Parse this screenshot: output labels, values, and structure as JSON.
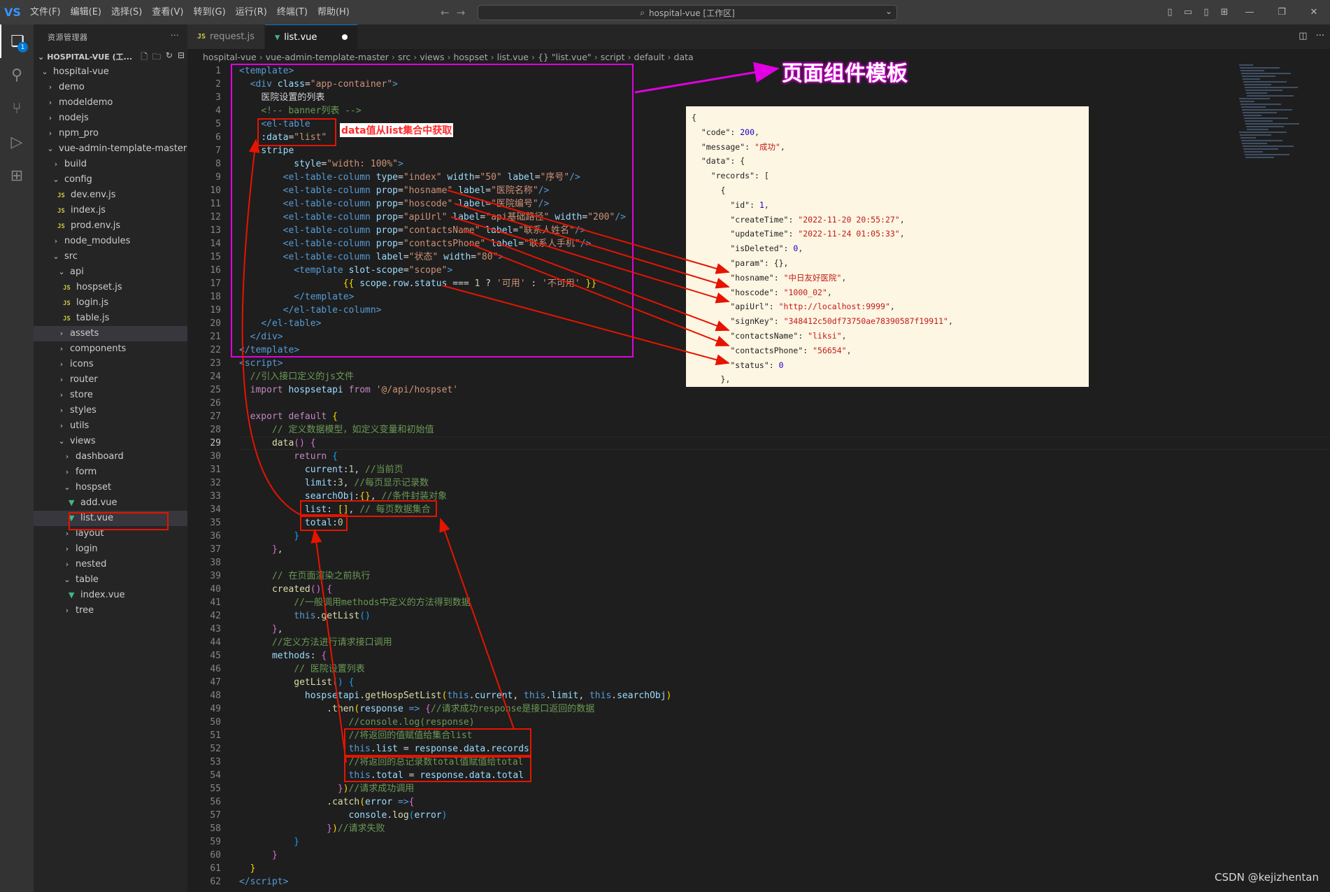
{
  "titlebar": {
    "logo": "VS",
    "menu": [
      "文件(F)",
      "编辑(E)",
      "选择(S)",
      "查看(V)",
      "转到(G)",
      "运行(R)",
      "终端(T)",
      "帮助(H)"
    ],
    "search": "hospital-vue [工作区]"
  },
  "sidebar": {
    "title": "资源管理器",
    "section": "HOSPITAL-VUE (工...",
    "items": [
      {
        "depth": 1,
        "type": "folder",
        "open": true,
        "label": "hospital-vue"
      },
      {
        "depth": 2,
        "type": "folder",
        "open": false,
        "label": "demo"
      },
      {
        "depth": 2,
        "type": "folder",
        "open": false,
        "label": "modeldemo"
      },
      {
        "depth": 2,
        "type": "folder",
        "open": false,
        "label": "nodejs"
      },
      {
        "depth": 2,
        "type": "folder",
        "open": false,
        "label": "npm_pro"
      },
      {
        "depth": 2,
        "type": "folder",
        "open": true,
        "label": "vue-admin-template-master"
      },
      {
        "depth": 3,
        "type": "folder",
        "open": false,
        "label": "build"
      },
      {
        "depth": 3,
        "type": "folder",
        "open": true,
        "label": "config"
      },
      {
        "depth": 4,
        "type": "js",
        "label": "dev.env.js"
      },
      {
        "depth": 4,
        "type": "js",
        "label": "index.js"
      },
      {
        "depth": 4,
        "type": "js",
        "label": "prod.env.js"
      },
      {
        "depth": 3,
        "type": "folder",
        "open": false,
        "label": "node_modules"
      },
      {
        "depth": 3,
        "type": "folder",
        "open": true,
        "label": "src"
      },
      {
        "depth": 4,
        "type": "folder",
        "open": true,
        "label": "api"
      },
      {
        "depth": 5,
        "type": "js",
        "label": "hospset.js"
      },
      {
        "depth": 5,
        "type": "js",
        "label": "login.js"
      },
      {
        "depth": 5,
        "type": "js",
        "label": "table.js"
      },
      {
        "depth": 4,
        "type": "folder",
        "open": false,
        "label": "assets",
        "selected": true
      },
      {
        "depth": 4,
        "type": "folder",
        "open": false,
        "label": "components"
      },
      {
        "depth": 4,
        "type": "folder",
        "open": false,
        "label": "icons"
      },
      {
        "depth": 4,
        "type": "folder",
        "open": false,
        "label": "router"
      },
      {
        "depth": 4,
        "type": "folder",
        "open": false,
        "label": "store"
      },
      {
        "depth": 4,
        "type": "folder",
        "open": false,
        "label": "styles"
      },
      {
        "depth": 4,
        "type": "folder",
        "open": false,
        "label": "utils"
      },
      {
        "depth": 4,
        "type": "folder",
        "open": true,
        "label": "views"
      },
      {
        "depth": 5,
        "type": "folder",
        "open": false,
        "label": "dashboard"
      },
      {
        "depth": 5,
        "type": "folder",
        "open": false,
        "label": "form"
      },
      {
        "depth": 5,
        "type": "folder",
        "open": true,
        "label": "hospset"
      },
      {
        "depth": 6,
        "type": "vue",
        "label": "add.vue"
      },
      {
        "depth": 6,
        "type": "vue",
        "label": "list.vue",
        "selected": true
      },
      {
        "depth": 5,
        "type": "folder",
        "open": false,
        "label": "layout"
      },
      {
        "depth": 5,
        "type": "folder",
        "open": false,
        "label": "login"
      },
      {
        "depth": 5,
        "type": "folder",
        "open": false,
        "label": "nested"
      },
      {
        "depth": 5,
        "type": "folder",
        "open": true,
        "label": "table"
      },
      {
        "depth": 6,
        "type": "vue",
        "label": "index.vue"
      },
      {
        "depth": 5,
        "type": "folder",
        "open": false,
        "label": "tree"
      }
    ]
  },
  "tabs": [
    {
      "icon": "JS",
      "label": "request.js",
      "active": false
    },
    {
      "icon": "vue",
      "label": "list.vue",
      "active": true
    }
  ],
  "breadcrumb": [
    "hospital-vue",
    "vue-admin-template-master",
    "src",
    "views",
    "hospset",
    "list.vue",
    "{} \"list.vue\"",
    "script",
    "default",
    "data"
  ],
  "code_lines": [
    {
      "n": 1,
      "html": "<span class='tag'>&lt;template&gt;</span>"
    },
    {
      "n": 2,
      "html": "  <span class='tag'>&lt;div</span> <span class='attr'>class</span><span class='txt'>=</span><span class='str'>\"app-container\"</span><span class='tag'>&gt;</span>"
    },
    {
      "n": 3,
      "html": "    <span class='txt'>医院设置的列表</span>"
    },
    {
      "n": 4,
      "html": "    <span class='com'>&lt;!-- banner列表 --&gt;</span>"
    },
    {
      "n": 5,
      "html": "    <span class='tag'>&lt;el-table</span>"
    },
    {
      "n": 6,
      "html": "    <span class='attr'>:data</span><span class='txt'>=</span><span class='str'>\"list\"</span>"
    },
    {
      "n": 7,
      "html": "    <span class='attr'>stripe</span>"
    },
    {
      "n": 8,
      "html": "          <span class='attr'>style</span><span class='txt'>=</span><span class='str'>\"width: 100%\"</span><span class='tag'>&gt;</span>"
    },
    {
      "n": 9,
      "html": "        <span class='tag'>&lt;el-table-column</span> <span class='attr'>type</span><span class='txt'>=</span><span class='str'>\"index\"</span> <span class='attr'>width</span><span class='txt'>=</span><span class='str'>\"50\"</span> <span class='attr'>label</span><span class='txt'>=</span><span class='str'>\"序号\"</span><span class='tag'>/&gt;</span>"
    },
    {
      "n": 10,
      "html": "        <span class='tag'>&lt;el-table-column</span> <span class='attr'>prop</span><span class='txt'>=</span><span class='str'>\"hosname\"</span> <span class='attr'>label</span><span class='txt'>=</span><span class='str'>\"医院名称\"</span><span class='tag'>/&gt;</span>"
    },
    {
      "n": 11,
      "html": "        <span class='tag'>&lt;el-table-column</span> <span class='attr'>prop</span><span class='txt'>=</span><span class='str'>\"hoscode\"</span> <span class='attr'>label</span><span class='txt'>=</span><span class='str'>\"医院编号\"</span><span class='tag'>/&gt;</span>"
    },
    {
      "n": 12,
      "html": "        <span class='tag'>&lt;el-table-column</span> <span class='attr'>prop</span><span class='txt'>=</span><span class='str'>\"apiUrl\"</span> <span class='attr'>label</span><span class='txt'>=</span><span class='str'>\"api基础路径\"</span> <span class='attr'>width</span><span class='txt'>=</span><span class='str'>\"200\"</span><span class='tag'>/&gt;</span>"
    },
    {
      "n": 13,
      "html": "        <span class='tag'>&lt;el-table-column</span> <span class='attr'>prop</span><span class='txt'>=</span><span class='str'>\"contactsName\"</span> <span class='attr'>label</span><span class='txt'>=</span><span class='str'>\"联系人姓名\"</span><span class='tag'>/&gt;</span>"
    },
    {
      "n": 14,
      "html": "        <span class='tag'>&lt;el-table-column</span> <span class='attr'>prop</span><span class='txt'>=</span><span class='str'>\"contactsPhone\"</span> <span class='attr'>label</span><span class='txt'>=</span><span class='str'>\"联系人手机\"</span><span class='tag'>/&gt;</span>"
    },
    {
      "n": 15,
      "html": "        <span class='tag'>&lt;el-table-column</span> <span class='attr'>label</span><span class='txt'>=</span><span class='str'>\"状态\"</span> <span class='attr'>width</span><span class='txt'>=</span><span class='str'>\"80\"</span><span class='tag'>&gt;</span>"
    },
    {
      "n": 16,
      "html": "          <span class='tag'>&lt;template</span> <span class='attr'>slot-scope</span><span class='txt'>=</span><span class='str'>\"scope\"</span><span class='tag'>&gt;</span>"
    },
    {
      "n": 17,
      "html": "                   <span class='brk'>{{</span> <span class='var'>scope</span><span class='txt'>.</span><span class='var'>row</span><span class='txt'>.</span><span class='var'>status</span> <span class='txt'>===</span> <span class='num'>1</span> <span class='txt'>?</span> <span class='str'>'可用'</span> <span class='txt'>:</span> <span class='str'>'不可用'</span> <span class='brk'>}}</span>"
    },
    {
      "n": 18,
      "html": "          <span class='tag'>&lt;/template&gt;</span>"
    },
    {
      "n": 19,
      "html": "        <span class='tag'>&lt;/el-table-column&gt;</span>"
    },
    {
      "n": 20,
      "html": "    <span class='tag'>&lt;/el-table&gt;</span>"
    },
    {
      "n": 21,
      "html": "  <span class='tag'>&lt;/div&gt;</span>"
    },
    {
      "n": 22,
      "html": "<span class='tag'>&lt;/template&gt;</span>"
    },
    {
      "n": 23,
      "html": "<span class='tag'>&lt;script&gt;</span>"
    },
    {
      "n": 24,
      "html": "  <span class='com'>//引入接口定义的js文件</span>"
    },
    {
      "n": 25,
      "html": "  <span class='kw'>import</span> <span class='var'>hospsetapi</span> <span class='kw'>from</span> <span class='str'>'@/api/hospset'</span>"
    },
    {
      "n": 26,
      "html": ""
    },
    {
      "n": 27,
      "html": "  <span class='kw'>export</span> <span class='kw'>default</span> <span class='brk'>{</span>"
    },
    {
      "n": 28,
      "html": "      <span class='com'>// 定义数据模型，如定义变量和初始值</span>"
    },
    {
      "n": 29,
      "html": "      <span class='fn'>data</span><span class='brk2'>()</span> <span class='brk2'>{</span>"
    },
    {
      "n": 30,
      "html": "          <span class='kw'>return</span> <span class='brk3'>{</span>"
    },
    {
      "n": 31,
      "html": "            <span class='var'>current</span><span class='txt'>:</span><span class='num'>1</span><span class='txt'>,</span> <span class='com'>//当前页</span>"
    },
    {
      "n": 32,
      "html": "            <span class='var'>limit</span><span class='txt'>:</span><span class='num'>3</span><span class='txt'>,</span> <span class='com'>//每页显示记录数</span>"
    },
    {
      "n": 33,
      "html": "            <span class='var'>searchObj</span><span class='txt'>:</span><span class='brk'>{}</span><span class='txt'>,</span> <span class='com'>//条件封装对象</span>"
    },
    {
      "n": 34,
      "html": "            <span class='var'>list</span><span class='txt'>:</span> <span class='brk'>[]</span><span class='txt'>,</span> <span class='com'>// 每页数据集合</span>"
    },
    {
      "n": 35,
      "html": "            <span class='var'>total</span><span class='txt'>:</span><span class='num'>0</span>"
    },
    {
      "n": 36,
      "html": "          <span class='brk3'>}</span>"
    },
    {
      "n": 37,
      "html": "      <span class='brk2'>}</span><span class='txt'>,</span>"
    },
    {
      "n": 38,
      "html": ""
    },
    {
      "n": 39,
      "html": "      <span class='com'>// 在页面渲染之前执行</span>"
    },
    {
      "n": 40,
      "html": "      <span class='fn'>created</span><span class='brk2'>()</span> <span class='brk2'>{</span>"
    },
    {
      "n": 41,
      "html": "          <span class='com'>//一般调用methods中定义的方法得到数据</span>"
    },
    {
      "n": 42,
      "html": "          <span class='kw2'>this</span><span class='txt'>.</span><span class='fn'>getList</span><span class='brk3'>()</span>"
    },
    {
      "n": 43,
      "html": "      <span class='brk2'>}</span><span class='txt'>,</span>"
    },
    {
      "n": 44,
      "html": "      <span class='com'>//定义方法进行请求接口调用</span>"
    },
    {
      "n": 45,
      "html": "      <span class='var'>methods</span><span class='txt'>:</span> <span class='brk2'>{</span>"
    },
    {
      "n": 46,
      "html": "          <span class='com'>// 医院设置列表</span>"
    },
    {
      "n": 47,
      "html": "          <span class='fn'>getList</span><span class='brk3'>()</span> <span class='brk3'>{</span>"
    },
    {
      "n": 48,
      "html": "            <span class='var'>hospsetapi</span><span class='txt'>.</span><span class='fn'>getHospSetList</span><span class='brk'>(</span><span class='kw2'>this</span><span class='txt'>.</span><span class='var'>current</span><span class='txt'>,</span> <span class='kw2'>this</span><span class='txt'>.</span><span class='var'>limit</span><span class='txt'>,</span> <span class='kw2'>this</span><span class='txt'>.</span><span class='var'>searchObj</span><span class='brk'>)</span>"
    },
    {
      "n": 49,
      "html": "                <span class='txt'>.</span><span class='fn'>then</span><span class='brk'>(</span><span class='var'>response</span> <span class='kw2'>=&gt;</span> <span class='brk2'>{</span><span class='com'>//请求成功response是接口返回的数据</span>"
    },
    {
      "n": 50,
      "html": "                    <span class='com'>//console.log(response)</span>"
    },
    {
      "n": 51,
      "html": "                    <span class='com'>//将返回的值赋值给集合list</span>"
    },
    {
      "n": 52,
      "html": "                    <span class='kw2'>this</span><span class='txt'>.</span><span class='var'>list</span> <span class='txt'>=</span> <span class='var'>response</span><span class='txt'>.</span><span class='var'>data</span><span class='txt'>.</span><span class='var'>records</span>"
    },
    {
      "n": 53,
      "html": "                    <span class='com'>//将返回的总记录数total值赋值给total</span>"
    },
    {
      "n": 54,
      "html": "                    <span class='kw2'>this</span><span class='txt'>.</span><span class='var'>total</span> <span class='txt'>=</span> <span class='var'>response</span><span class='txt'>.</span><span class='var'>data</span><span class='txt'>.</span><span class='var'>total</span>"
    },
    {
      "n": 55,
      "html": "                  <span class='brk2'>}</span><span class='brk'>)</span><span class='com'>//请求成功调用</span>"
    },
    {
      "n": 56,
      "html": "                <span class='txt'>.</span><span class='fn'>catch</span><span class='brk'>(</span><span class='var'>error</span> <span class='kw2'>=&gt;</span><span class='brk2'>{</span>"
    },
    {
      "n": 57,
      "html": "                    <span class='var'>console</span><span class='txt'>.</span><span class='fn'>log</span><span class='brk3'>(</span><span class='var'>error</span><span class='brk3'>)</span>"
    },
    {
      "n": 58,
      "html": "                <span class='brk2'>}</span><span class='brk'>)</span><span class='com'>//请求失败</span>"
    },
    {
      "n": 59,
      "html": "          <span class='brk3'>}</span>"
    },
    {
      "n": 60,
      "html": "      <span class='brk2'>}</span>"
    },
    {
      "n": 61,
      "html": "  <span class='brk'>}</span>"
    },
    {
      "n": 62,
      "html": "<span class='tag'>&lt;/script&gt;</span>"
    }
  ],
  "current_line": 29,
  "json_panel_lines": [
    "<span class='jk'>{</span>",
    "<span class='jk'>  \"code\": </span><span class='jn'>200</span>,",
    "<span class='jk'>  \"message\": </span><span class='js2'>\"成功\"</span>,",
    "<span class='jk'>  \"data\": {</span>",
    "<span class='jk'>    \"records\": [</span>",
    "<span class='jk'>      {</span>",
    "<span class='jk'>        \"id\": </span><span class='jn'>1</span>,",
    "<span class='jk'>        \"createTime\": </span><span class='js2'>\"2022-11-20 20:55:27\"</span>,",
    "<span class='jk'>        \"updateTime\": </span><span class='js2'>\"2022-11-24 01:05:33\"</span>,",
    "<span class='jk'>        \"isDeleted\": </span><span class='jn'>0</span>,",
    "<span class='jk'>        \"param\": {},</span>",
    "<span class='jk'>        \"hosname\": </span><span class='js2'>\"中日友好医院\"</span>,",
    "<span class='jk'>        \"hoscode\": </span><span class='js2'>\"1000_02\"</span>,",
    "<span class='jk'>        \"apiUrl\": </span><span class='js2'>\"http://localhost:9999\"</span>,",
    "<span class='jk'>        \"signKey\": </span><span class='js2'>\"348412c50df73750ae78390587f19911\"</span>,",
    "<span class='jk'>        \"contactsName\": </span><span class='js2'>\"liksi\"</span>,",
    "<span class='jk'>        \"contactsPhone\": </span><span class='js2'>\"56654\"</span>,",
    "<span class='jk'>        \"status\": </span><span class='jn'>0</span>",
    "<span class='jk'>      },</span>"
  ],
  "annotations": {
    "title": "页面组件模板",
    "data_note": "data值从list集合中获取"
  },
  "watermark": "CSDN @kejizhentan",
  "colors": {
    "annotation_red": "#e51400",
    "annotation_magenta": "#e100e1",
    "json_bg": "#fdf6e3"
  }
}
